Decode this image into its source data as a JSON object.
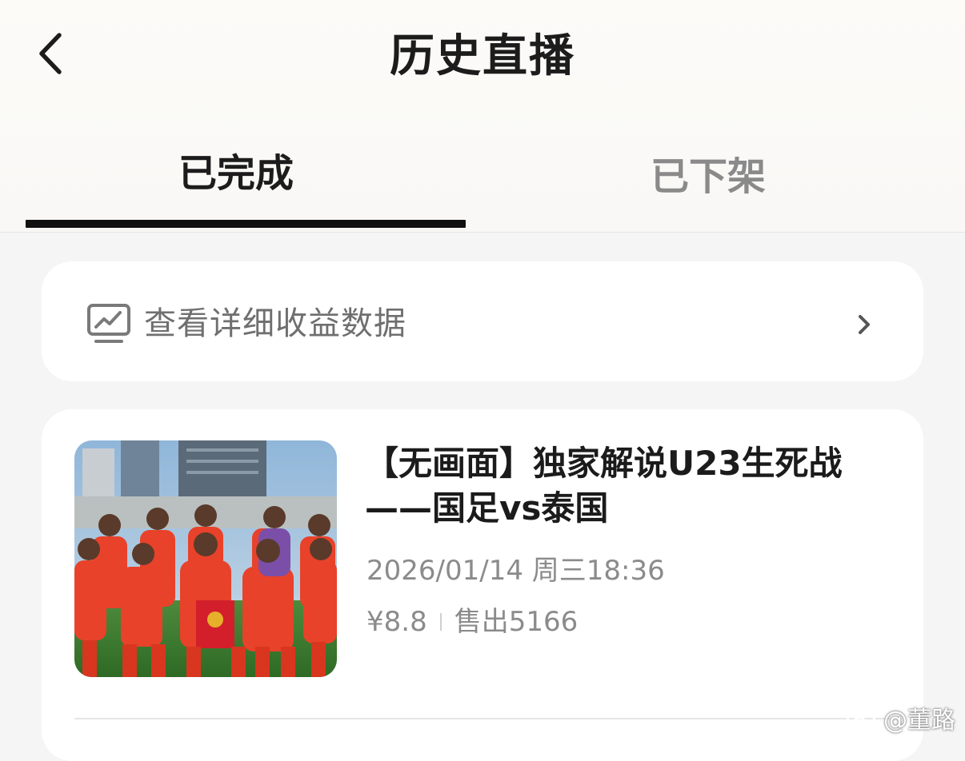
{
  "header": {
    "title": "历史直播"
  },
  "tabs": [
    {
      "label": "已完成",
      "active": true
    },
    {
      "label": "已下架",
      "active": false
    }
  ],
  "earnings": {
    "label": "查看详细收益数据"
  },
  "live_items": [
    {
      "title_line1": "【无画面】独家解说U23生死战",
      "title_line2": "——国足vs泰国",
      "datetime": "2026/01/14 周三18:36",
      "price": "¥8.8",
      "sold": "售出5166"
    }
  ],
  "watermark": {
    "text": "@董路"
  },
  "icons": {
    "back": "chevron-left-icon",
    "earnings": "monitor-chart-icon",
    "earnings_arrow": "chevron-right-icon",
    "watermark": "weibo-logo-icon"
  },
  "colors": {
    "active_text": "#1c1c1c",
    "inactive_text": "#8a8a8a",
    "secondary_text": "#8b8b8b",
    "indicator": "#111111",
    "card_background": "#ffffff",
    "page_background": "#f5f5f5"
  }
}
